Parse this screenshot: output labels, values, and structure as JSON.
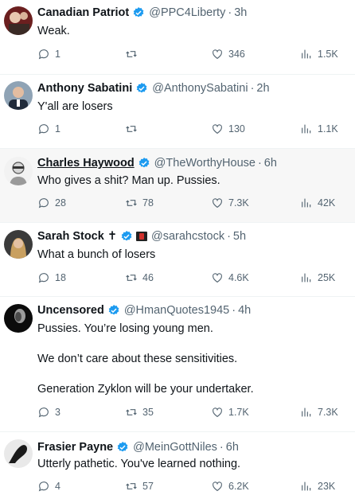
{
  "colors": {
    "verified": "#1d9bf0",
    "text": "#0f1419",
    "muted": "#536471"
  },
  "icons": {
    "reply": "reply-icon",
    "retweet": "retweet-icon",
    "like": "like-icon",
    "views": "views-icon",
    "verified": "verified-badge-icon"
  },
  "tweets": [
    {
      "name": "Canadian Patriot",
      "handle": "@PPC4Liberty",
      "time": "3h",
      "text": [
        "Weak."
      ],
      "replies": "1",
      "retweets": "",
      "likes": "346",
      "views": "1.5K"
    },
    {
      "name": "Anthony Sabatini",
      "handle": "@AnthonySabatini",
      "time": "2h",
      "text": [
        "Y'all are losers"
      ],
      "replies": "1",
      "retweets": "",
      "likes": "130",
      "views": "1.1K"
    },
    {
      "name": "Charles Haywood",
      "handle": "@TheWorthyHouse",
      "time": "6h",
      "text": [
        "Who gives a shit?  Man up.  Pussies."
      ],
      "replies": "28",
      "retweets": "78",
      "likes": "7.3K",
      "views": "42K"
    },
    {
      "name": "Sarah Stock",
      "name_suffix": "✝",
      "handle": "@sarahcstock",
      "time": "5h",
      "text": [
        "What a bunch of losers"
      ],
      "replies": "18",
      "retweets": "46",
      "likes": "4.6K",
      "views": "25K"
    },
    {
      "name": "Uncensored",
      "handle": "@HmanQuotes1945",
      "time": "4h",
      "text": [
        "Pussies. You’re losing young men.",
        "We don’t care about these sensitivities.",
        "Generation Zyklon will be your undertaker."
      ],
      "replies": "3",
      "retweets": "35",
      "likes": "1.7K",
      "views": "7.3K"
    },
    {
      "name": "Frasier Payne",
      "handle": "@MeinGottNiles",
      "time": "6h",
      "text": [
        "Utterly pathetic. You've learned nothing."
      ],
      "replies": "4",
      "retweets": "57",
      "likes": "6.2K",
      "views": "23K"
    }
  ]
}
